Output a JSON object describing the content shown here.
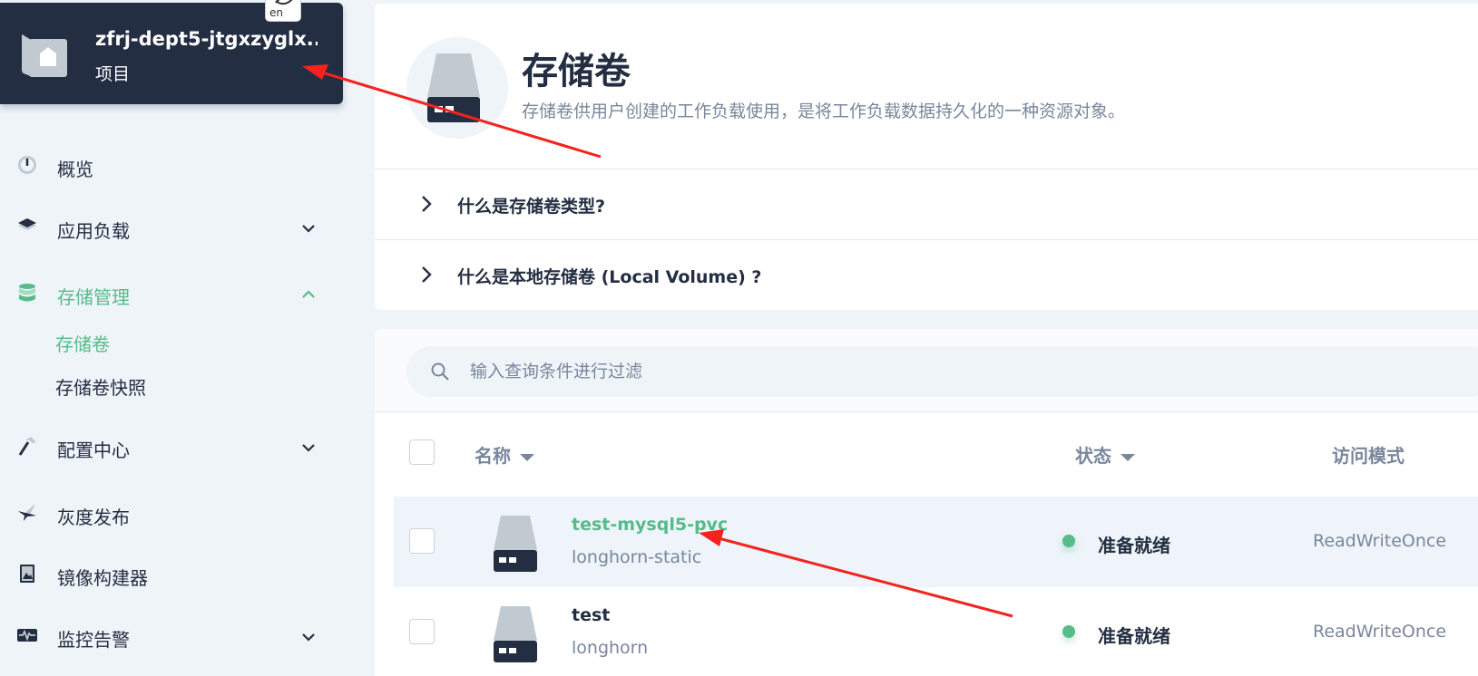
{
  "project": {
    "name": "zfrj-dept5-jtgxzyglx...",
    "type": "项目",
    "lang_badge": "en"
  },
  "nav": {
    "overview": "概览",
    "workloads": "应用负载",
    "storage": "存储管理",
    "storage_sub": {
      "volumes": "存储卷",
      "snapshots": "存储卷快照"
    },
    "config": "配置中心",
    "grayscale": "灰度发布",
    "image_builder": "镜像构建器",
    "monitoring": "监控告警"
  },
  "hero": {
    "title": "存储卷",
    "description": "存储卷供用户创建的工作负载使用，是将工作负载数据持久化的一种资源对象。"
  },
  "faq": [
    "什么是存储卷类型?",
    "什么是本地存储卷 (Local Volume) ?"
  ],
  "search": {
    "placeholder": "输入查询条件进行过滤"
  },
  "table": {
    "headers": {
      "name": "名称",
      "status": "状态",
      "access_mode": "访问模式"
    },
    "rows": [
      {
        "name": "test-mysql5-pvc",
        "storage_class": "longhorn-static",
        "status": "准备就绪",
        "access_mode": "ReadWriteOnce"
      },
      {
        "name": "test",
        "storage_class": "longhorn",
        "status": "准备就绪",
        "access_mode": "ReadWriteOnce"
      }
    ]
  },
  "colors": {
    "dark": "#242e42",
    "accent_green": "#55bc8a",
    "muted": "#79879c",
    "background": "#eff4f9",
    "annotation_arrow": "#f5221e"
  }
}
